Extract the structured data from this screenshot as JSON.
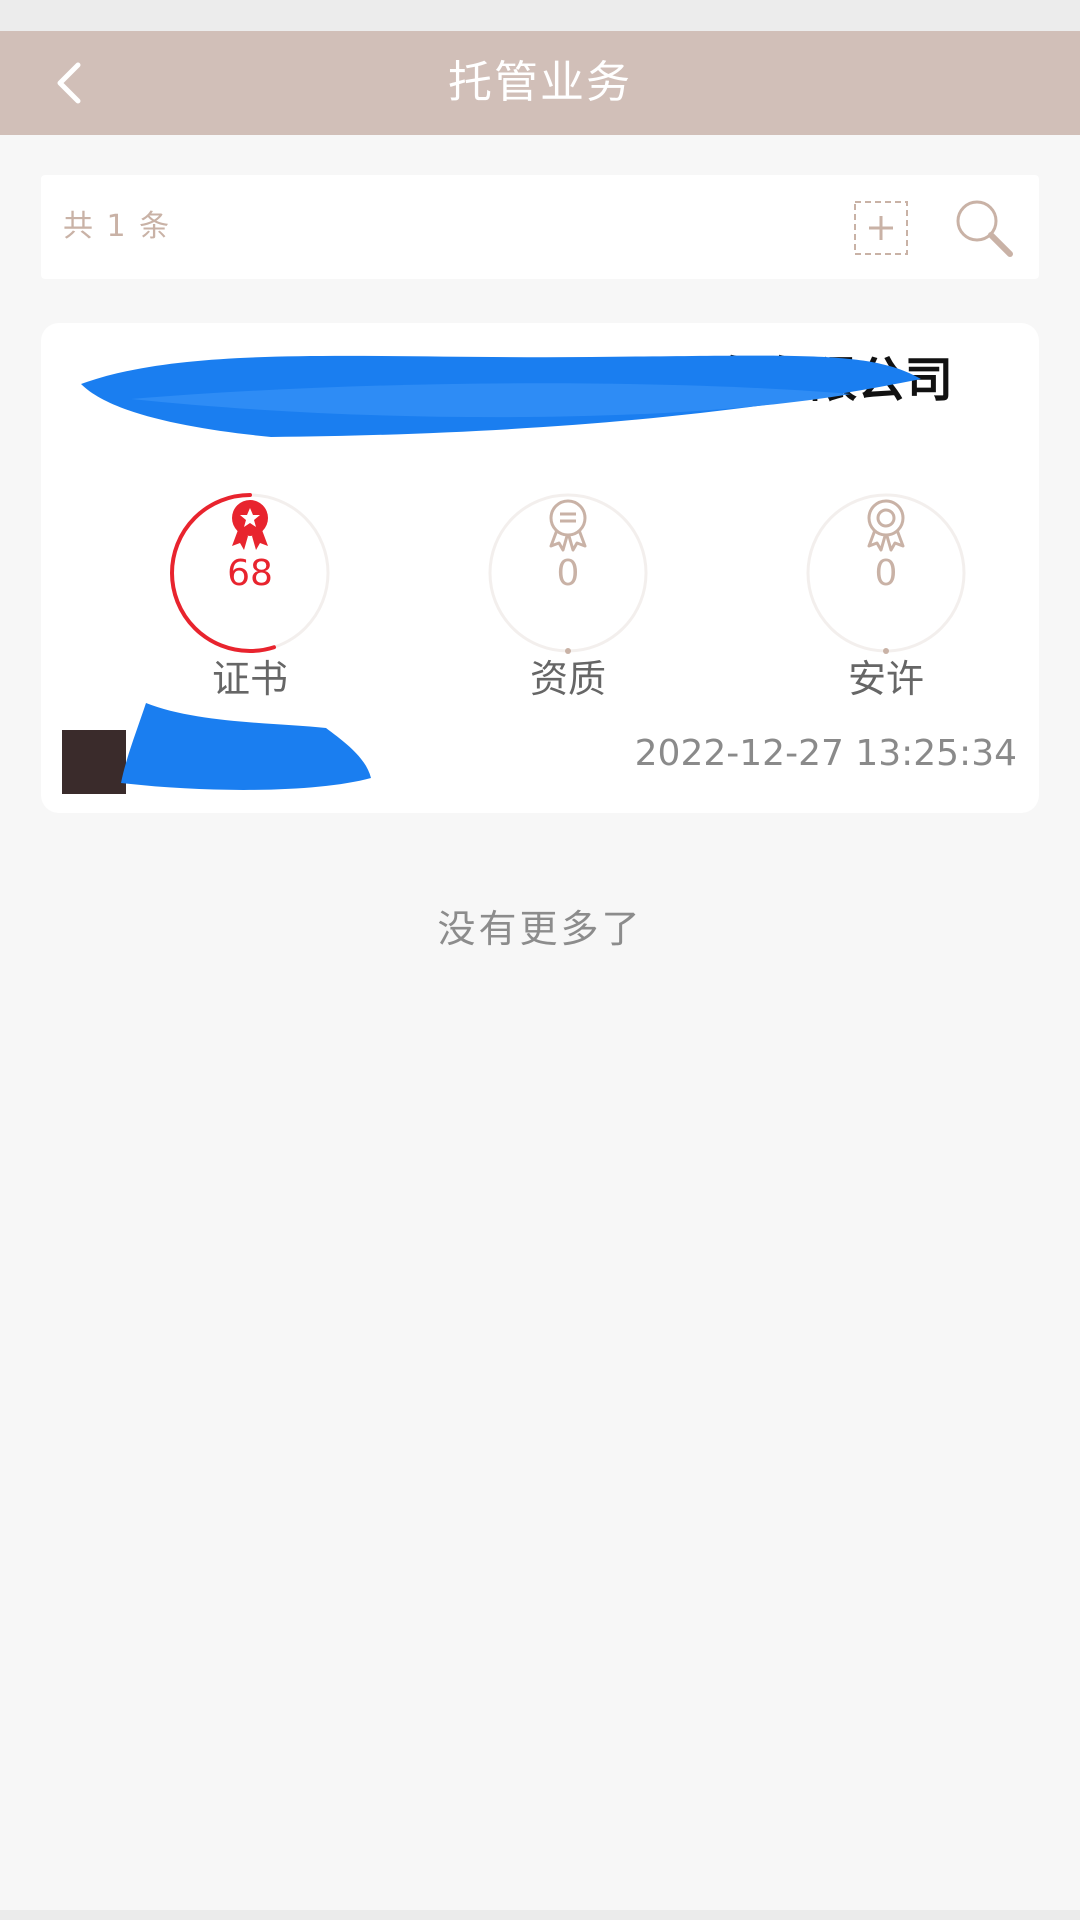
{
  "header": {
    "title": "托管业务",
    "back_icon": "chevron-left-icon"
  },
  "toolbar": {
    "count_label": "共 1 条",
    "add_icon": "add-square-icon",
    "search_icon": "search-icon"
  },
  "card": {
    "company_name": "务有限公司",
    "stats": [
      {
        "label": "证书",
        "value": "68",
        "icon": "certificate-award-icon",
        "color": "#e8242e",
        "progress": 0.55
      },
      {
        "label": "资质",
        "value": "0",
        "icon": "qualification-award-icon",
        "color": "#c9b2a6",
        "progress": 0
      },
      {
        "label": "安许",
        "value": "0",
        "icon": "safety-license-award-icon",
        "color": "#c9b2a6",
        "progress": 0
      }
    ],
    "datetime": "2022-12-27 13:25:34"
  },
  "footer": {
    "no_more": "没有更多了"
  },
  "colors": {
    "nav_bg": "#d1bfb8",
    "accent_red": "#e8242e",
    "muted": "#c9b2a6"
  }
}
